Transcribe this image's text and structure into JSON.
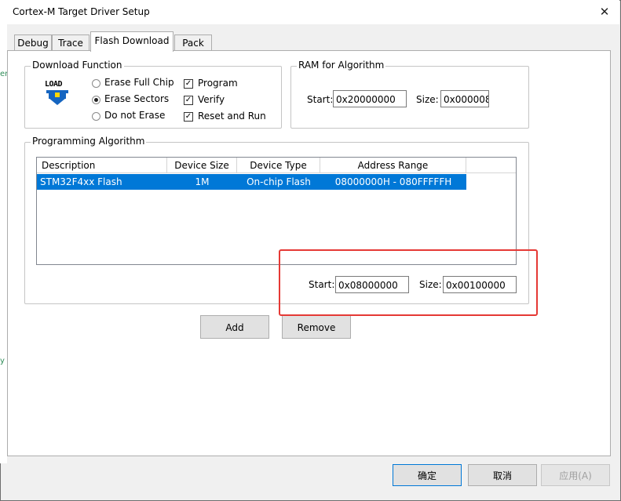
{
  "window": {
    "title": "Cortex-M Target Driver Setup",
    "close_glyph": "✕"
  },
  "left_strip": {
    "frag1": "er",
    "frag2": "y"
  },
  "tabs": [
    {
      "label": "Debug"
    },
    {
      "label": "Trace"
    },
    {
      "label": "Flash Download"
    },
    {
      "label": "Pack"
    }
  ],
  "download_function": {
    "legend": "Download Function",
    "load_icon_text": "LOAD",
    "radios": [
      {
        "label": "Erase Full Chip",
        "selected": false
      },
      {
        "label": "Erase Sectors",
        "selected": true
      },
      {
        "label": "Do not Erase",
        "selected": false
      }
    ],
    "checks": [
      {
        "label": "Program",
        "checked": true
      },
      {
        "label": "Verify",
        "checked": true
      },
      {
        "label": "Reset and Run",
        "checked": true
      }
    ]
  },
  "ram": {
    "legend": "RAM for Algorithm",
    "start_label": "Start:",
    "start_value": "0x20000000",
    "size_label": "Size:",
    "size_value": "0x000008"
  },
  "programming_algorithm": {
    "legend": "Programming Algorithm",
    "columns": [
      "Description",
      "Device Size",
      "Device Type",
      "Address Range"
    ],
    "rows": [
      [
        "STM32F4xx Flash",
        "1M",
        "On-chip Flash",
        "08000000H - 080FFFFFH"
      ]
    ],
    "start_label": "Start:",
    "start_value": "0x08000000",
    "size_label": "Size:",
    "size_value": "0x00100000"
  },
  "buttons": {
    "add": "Add",
    "remove": "Remove",
    "ok": "确定",
    "cancel": "取消",
    "apply": "应用(A)"
  },
  "colors": {
    "selection": "#0078d7",
    "highlight_box": "#e53935",
    "load_icon": "#1565c0"
  }
}
